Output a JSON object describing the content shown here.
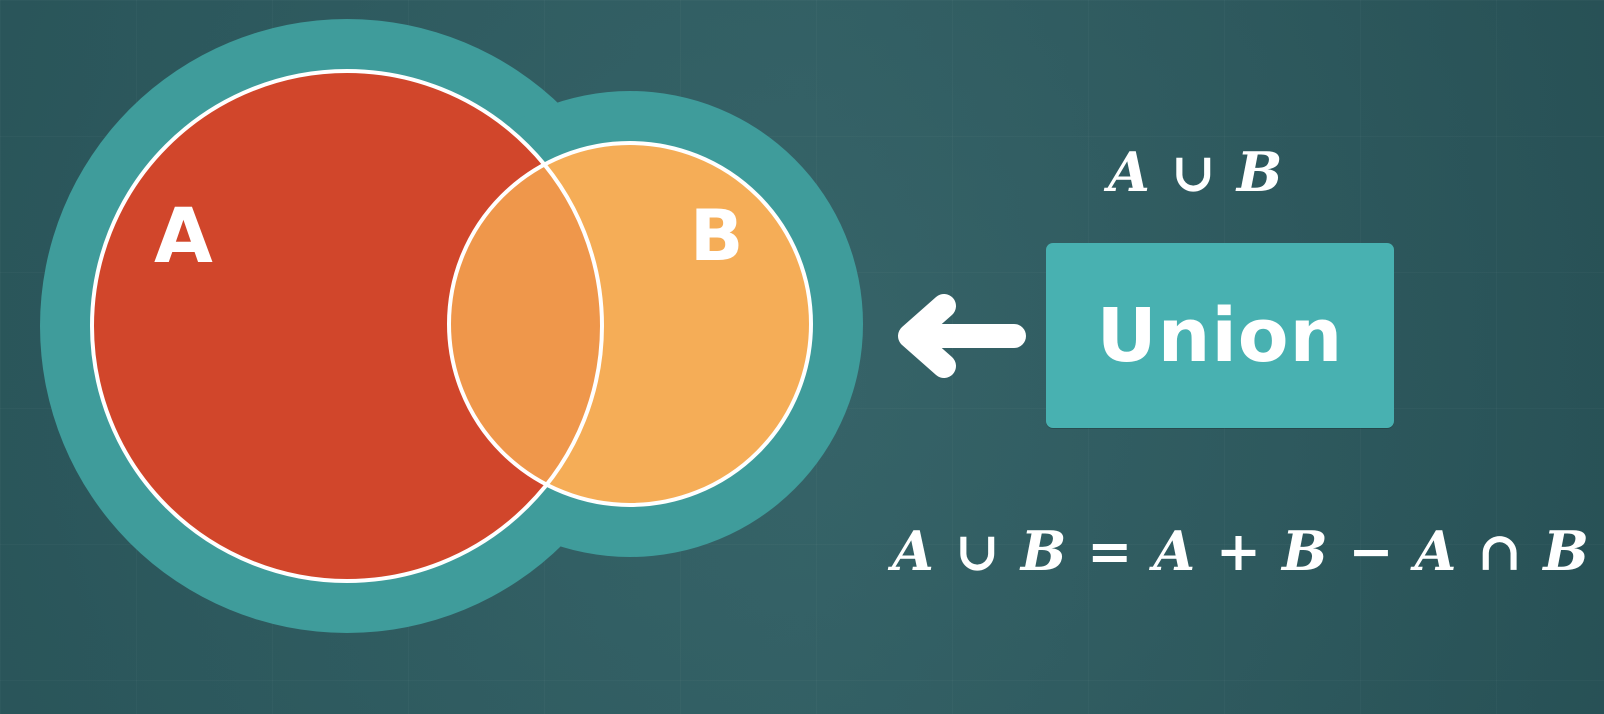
{
  "diagram": {
    "set_a_label": "A",
    "set_b_label": "B",
    "union_label": "Union",
    "top_expression": "A ∪ B",
    "bottom_expression": "A ∪ B = A + B  − A ∩ B",
    "colors": {
      "background": "#2f5d62",
      "outline": "#3f9c9b",
      "set_a": "#d1462b",
      "set_b": "#f5ad57",
      "intersection": "#ef974b",
      "label_box": "#48b1b1",
      "text": "#ffffff"
    },
    "icons": {
      "arrow": "left-arrow-icon"
    }
  }
}
